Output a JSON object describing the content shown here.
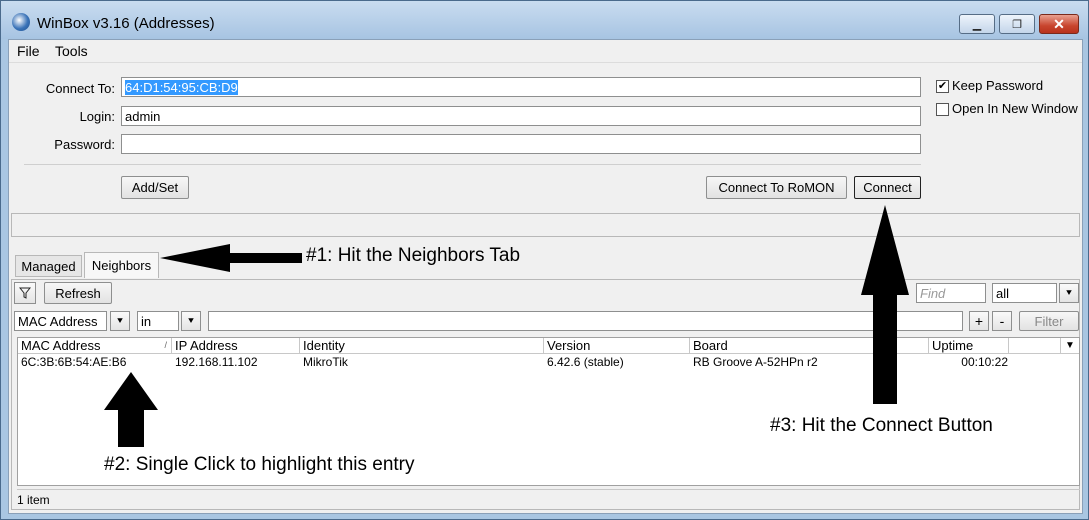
{
  "window": {
    "title": "WinBox v3.16 (Addresses)"
  },
  "menu": [
    "File",
    "Tools"
  ],
  "form": {
    "connect_to_label": "Connect To:",
    "connect_to_value": "64:D1:54:95:CB:D9",
    "login_label": "Login:",
    "login_value": "admin",
    "password_label": "Password:",
    "password_value": "",
    "keep_password_label": "Keep Password",
    "keep_password_checked": true,
    "open_new_window_label": "Open In New Window",
    "open_new_window_checked": false,
    "add_set_label": "Add/Set",
    "connect_romon_label": "Connect To RoMON",
    "connect_label": "Connect"
  },
  "tabs": [
    "Managed",
    "Neighbors"
  ],
  "toolbar": {
    "refresh_label": "Refresh",
    "find_placeholder": "Find",
    "find_scope": "all",
    "filter_field": "MAC Address",
    "filter_op": "in",
    "filter_value": "",
    "plus": "+",
    "minus": "-",
    "filter_label": "Filter"
  },
  "table": {
    "columns": [
      "MAC Address",
      "IP Address",
      "Identity",
      "Version",
      "Board",
      "Uptime"
    ],
    "rows": [
      [
        "6C:3B:6B:54:AE:B6",
        "192.168.11.102",
        "MikroTik",
        "6.42.6 (stable)",
        "RB Groove A-52HPn r2",
        "00:10:22"
      ]
    ]
  },
  "status": {
    "count": "1 item"
  },
  "annotations": {
    "step1": "#1: Hit the Neighbors Tab",
    "step2": "#2:  Single Click to highlight this entry",
    "step3": "#3:  Hit the Connect Button"
  },
  "colors": {
    "selection": "#3399ff",
    "title_gradient_top": "#c9dcf0",
    "close_button": "#c8452e"
  }
}
